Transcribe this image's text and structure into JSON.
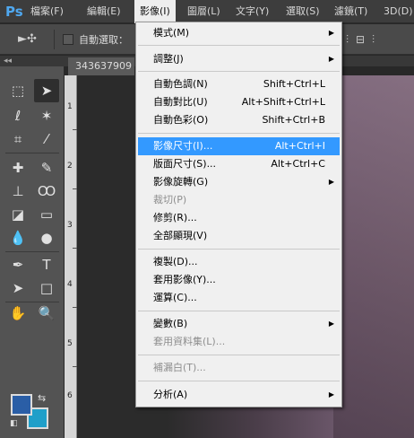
{
  "app": {
    "logo": "Ps"
  },
  "menubar": {
    "items": [
      "檔案(F)",
      "編輯(E)",
      "影像(I)",
      "圖層(L)",
      "文字(Y)",
      "選取(S)",
      "濾鏡(T)",
      "3D(D)"
    ]
  },
  "options": {
    "auto_select_label": "自動選取：",
    "auto_select_checked": false
  },
  "document": {
    "tab_title": "343637909"
  },
  "ruler": {
    "labels": [
      "1",
      "2",
      "3",
      "4",
      "5",
      "6"
    ]
  },
  "colors": {
    "foreground": "#2a5ea6",
    "background": "#1f9fc9",
    "menu_highlight": "#3399ff"
  },
  "image_menu": {
    "items": [
      {
        "label": "模式(M)",
        "submenu": true
      },
      {
        "label": "調整(J)",
        "submenu": true
      },
      {
        "label": "自動色調(N)",
        "shortcut": "Shift+Ctrl+L"
      },
      {
        "label": "自動對比(U)",
        "shortcut": "Alt+Shift+Ctrl+L"
      },
      {
        "label": "自動色彩(O)",
        "shortcut": "Shift+Ctrl+B"
      },
      {
        "label": "影像尺寸(I)...",
        "shortcut": "Alt+Ctrl+I",
        "highlighted": true
      },
      {
        "label": "版面尺寸(S)...",
        "shortcut": "Alt+Ctrl+C"
      },
      {
        "label": "影像旋轉(G)",
        "submenu": true
      },
      {
        "label": "裁切(P)",
        "disabled": true
      },
      {
        "label": "修剪(R)..."
      },
      {
        "label": "全部顯現(V)"
      },
      {
        "label": "複製(D)..."
      },
      {
        "label": "套用影像(Y)..."
      },
      {
        "label": "運算(C)..."
      },
      {
        "label": "變數(B)",
        "submenu": true
      },
      {
        "label": "套用資料集(L)...",
        "disabled": true
      },
      {
        "label": "補漏白(T)...",
        "disabled": true
      },
      {
        "label": "分析(A)",
        "submenu": true
      }
    ]
  }
}
